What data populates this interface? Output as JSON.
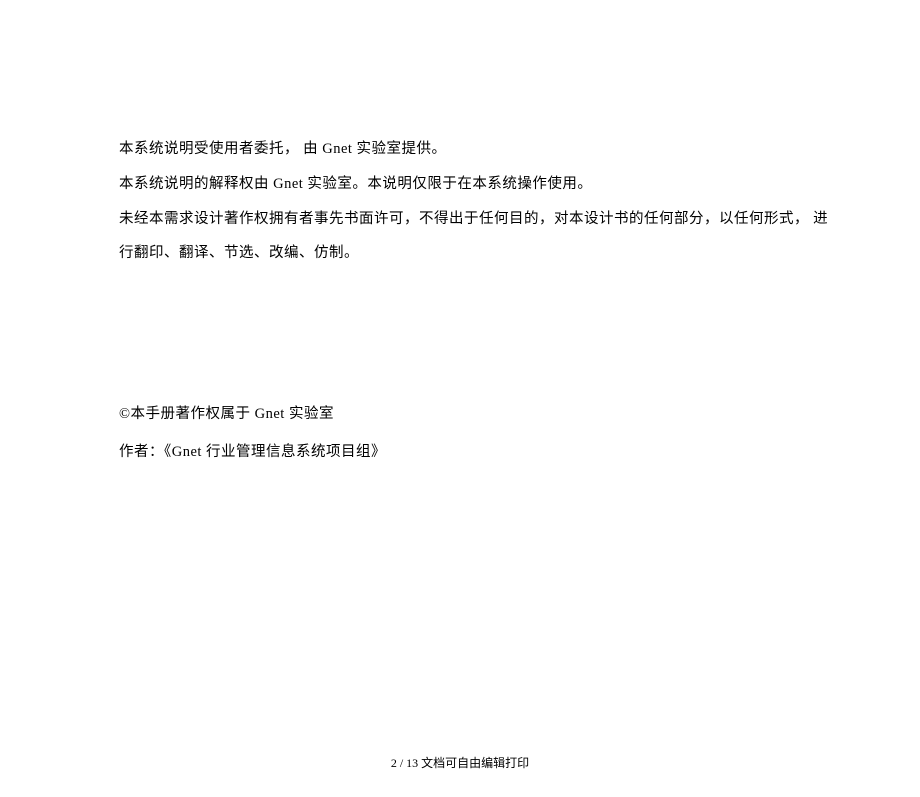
{
  "body": {
    "lines": [
      "本系统说明受使用者委托， 由 Gnet 实验室提供。",
      "本系统说明的解释权由 Gnet 实验室。本说明仅限于在本系统操作使用。",
      "未经本需求设计著作权拥有者事先书面许可，不得出于任何目的，对本设计书的任何部分，以任何形式， 进行翻印、翻译、节选、改编、仿制。"
    ]
  },
  "copyright": {
    "line1": "©本手册著作权属于 Gnet 实验室",
    "line2": "作者：《Gnet 行业管理信息系统项目组》"
  },
  "footer": {
    "text": "2 / 13 文档可自由编辑打印"
  }
}
